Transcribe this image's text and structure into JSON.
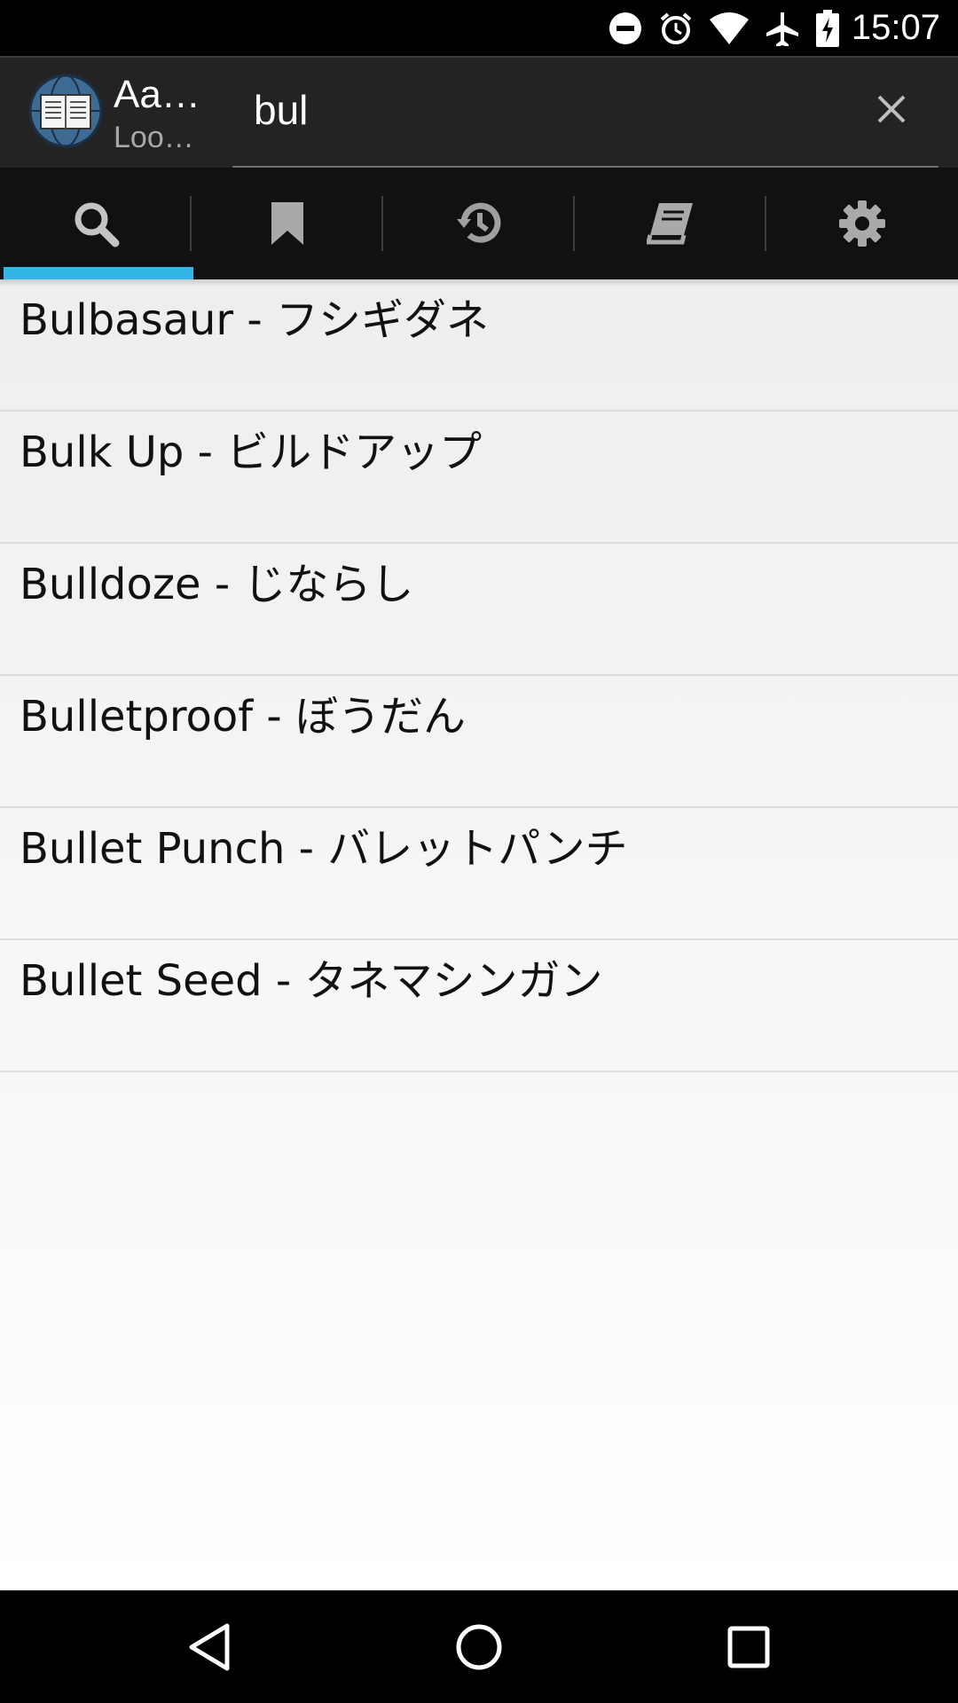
{
  "status_bar": {
    "time": "15:07",
    "icons": [
      "do-not-disturb-icon",
      "alarm-icon",
      "wifi-icon",
      "airplane-mode-icon",
      "battery-charging-icon"
    ]
  },
  "app_bar": {
    "title": "Aa…",
    "subtitle": "Loo…",
    "search_value": "bul",
    "search_placeholder": "",
    "clear_icon": "close-icon"
  },
  "tabs": [
    {
      "icon": "search-icon",
      "selected": true
    },
    {
      "icon": "bookmark-icon",
      "selected": false
    },
    {
      "icon": "history-icon",
      "selected": false
    },
    {
      "icon": "dictionaries-icon",
      "selected": false
    },
    {
      "icon": "settings-gear-icon",
      "selected": false
    }
  ],
  "colors": {
    "accent": "#33b5e5",
    "action_bar": "#232323",
    "tab_bar": "#111111"
  },
  "results": [
    {
      "text": "Bulbasaur  -  フシギダネ"
    },
    {
      "text": "Bulk Up  -  ビルドアップ"
    },
    {
      "text": "Bulldoze  -  じならし"
    },
    {
      "text": "Bulletproof  -  ぼうだん"
    },
    {
      "text": "Bullet Punch  -  バレットパンチ"
    },
    {
      "text": "Bullet Seed  -  タネマシンガン"
    }
  ],
  "nav_bar": {
    "icons": [
      "back-icon",
      "home-icon",
      "recents-icon"
    ]
  }
}
